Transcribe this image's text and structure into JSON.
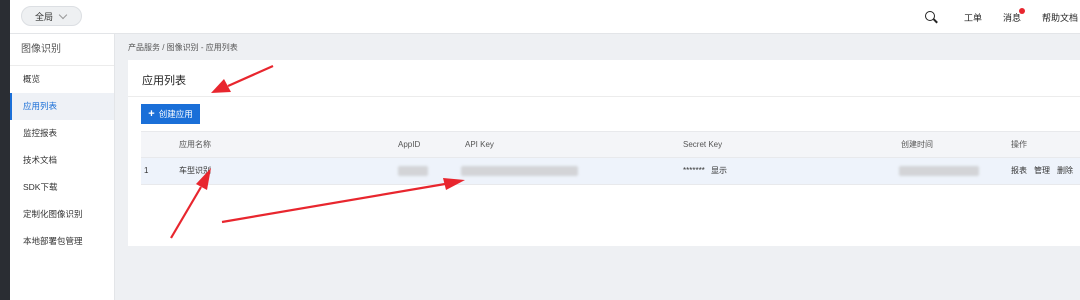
{
  "topbar": {
    "scope_label": "全局",
    "links": [
      "工单",
      "消息",
      "帮助文档"
    ]
  },
  "sidebar": {
    "title": "图像识别",
    "items": [
      {
        "label": "概览",
        "active": false
      },
      {
        "label": "应用列表",
        "active": true
      },
      {
        "label": "监控报表",
        "active": false
      },
      {
        "label": "技术文档",
        "active": false
      },
      {
        "label": "SDK下载",
        "active": false
      },
      {
        "label": "定制化图像识别",
        "active": false
      },
      {
        "label": "本地部署包管理",
        "active": false
      }
    ]
  },
  "breadcrumb": "产品服务 / 图像识别 - 应用列表",
  "main": {
    "title": "应用列表",
    "create_button": "创建应用",
    "table": {
      "columns": [
        "应用名称",
        "AppID",
        "API Key",
        "Secret Key",
        "创建时间",
        "操作"
      ],
      "rows": [
        {
          "index": "1",
          "name": "车型识别",
          "secret_masked": "*******",
          "show_label": "显示",
          "actions": [
            "报表",
            "管理",
            "删除"
          ]
        }
      ]
    }
  },
  "colors": {
    "accent": "#1a6fd8",
    "danger": "#e8262e",
    "annotation_arrow": "#e8262e"
  }
}
